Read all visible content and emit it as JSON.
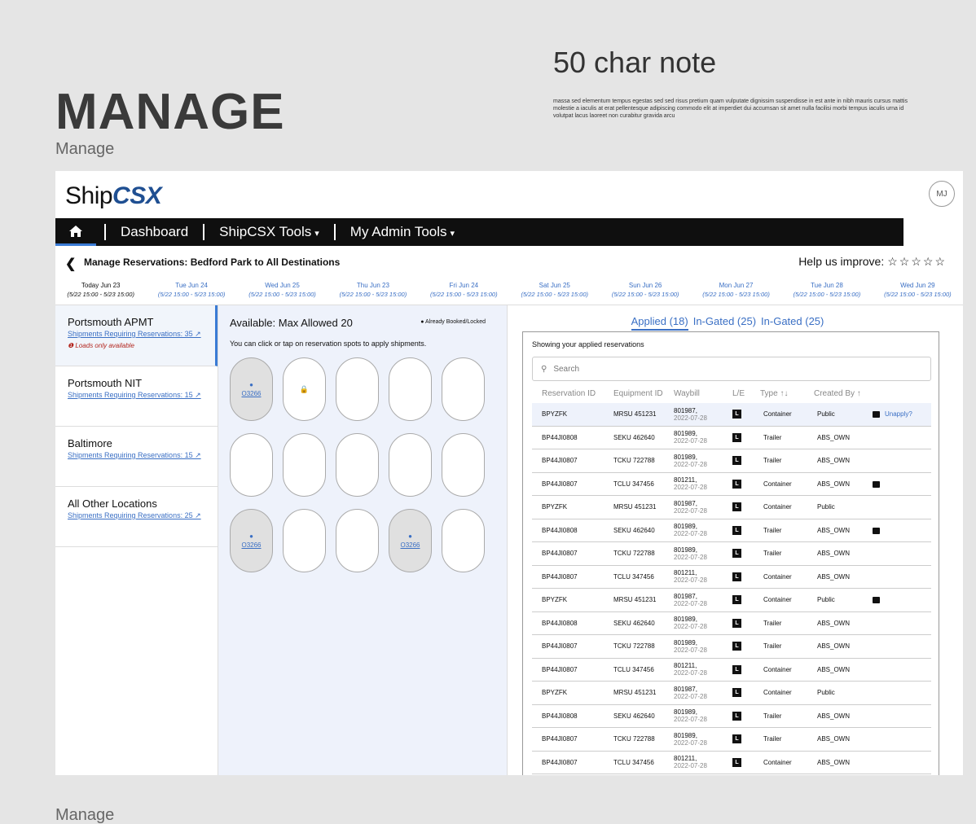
{
  "cover": {
    "title": "MANAGE",
    "subtitle": "Manage",
    "bottom_label": "Manage"
  },
  "note": {
    "title": "50 char note",
    "body": "massa sed elementum tempus egestas sed sed risus pretium quam vulputate dignissim suspendisse in est ante in nibh mauris cursus mattis molestie a iaculis at erat pellentesque adipiscing commodo elit at imperdiet dui accumsan sit amet nulla facilisi morbi tempus iaculis urna id volutpat lacus laoreet non curabitur gravida arcu"
  },
  "header": {
    "logo_ship": "Ship",
    "logo_csx": "CSX",
    "avatar": "MJ"
  },
  "nav": {
    "home_icon": "home-icon",
    "dashboard": "Dashboard",
    "tools": "ShipCSX Tools",
    "admin": "My Admin Tools",
    "caret": "▾"
  },
  "page": {
    "back": "❮",
    "title": "Manage Reservations: Bedford Park to All Destinations",
    "help": "Help us improve:",
    "stars": "☆☆☆☆☆"
  },
  "dates": [
    {
      "day": "Today Jun 23",
      "range": "(5/22 15:00 - 5/23 15:00)"
    },
    {
      "day": "Tue Jun 24",
      "range": "(5/22 15:00 - 5/23 15:00)"
    },
    {
      "day": "Wed Jun 25",
      "range": "(5/22 15:00 - 5/23 15:00)"
    },
    {
      "day": "Thu Jun 23",
      "range": "(5/22 15:00 - 5/23 15:00)"
    },
    {
      "day": "Fri Jun 24",
      "range": "(5/22 15:00 - 5/23 15:00)"
    },
    {
      "day": "Sat Jun 25",
      "range": "(5/22 15:00 - 5/23 15:00)"
    },
    {
      "day": "Sun Jun 26",
      "range": "(5/22 15:00 - 5/23 15:00)"
    },
    {
      "day": "Mon Jun 27",
      "range": "(5/22 15:00 - 5/23 15:00)"
    },
    {
      "day": "Tue Jun 28",
      "range": "(5/22 15:00 - 5/23 15:00)"
    },
    {
      "day": "Wed Jun 29",
      "range": "(5/22 15:00 - 5/23 15:00)"
    }
  ],
  "locations": [
    {
      "name": "Portsmouth APMT",
      "link": "Shipments Requiring Reservations: 35 ↗",
      "warn": "❶ Loads only available"
    },
    {
      "name": "Portsmouth NIT",
      "link": "Shipments Requiring Reservations: 15 ↗",
      "warn": ""
    },
    {
      "name": "Baltimore",
      "link": "Shipments Requiring Reservations: 15 ↗",
      "warn": ""
    },
    {
      "name": "All Other Locations",
      "link": "Shipments Requiring Reservations: 25 ↗",
      "warn": ""
    }
  ],
  "spots": {
    "available": "Available: Max Allowed 20",
    "booked_legend": "● Already Booked/Locked",
    "instructions": "You can click or tap on reservation spots to apply shipments.",
    "booked_code": "O3266",
    "user_icon": "●",
    "lock_icon": "🔒"
  },
  "tabs": {
    "applied": "Applied (18)",
    "ingated1": "In-Gated (25)",
    "ingated2": "In-Gated (25)"
  },
  "table": {
    "showing": "Showing your applied reservations",
    "search_placeholder": "Search",
    "search_icon": "⚲",
    "headers": {
      "res": "Reservation ID",
      "eq": "Equipment ID",
      "wb": "Waybill",
      "le": "L/E",
      "type": "Type ↑↓",
      "by": "Created By ↑"
    },
    "unapply": "Unapply?",
    "rows": [
      {
        "res": "BPYZFK",
        "eq": "MRSU 451231",
        "wb": "801987,",
        "date": "2022-07-28",
        "le": "L",
        "type": "Container",
        "by": "Public",
        "note": true,
        "unapply": true
      },
      {
        "res": "BP44JI0808",
        "eq": "SEKU 462640",
        "wb": "801989,",
        "date": "2022-07-28",
        "le": "L",
        "type": "Trailer",
        "by": "ABS_OWN",
        "note": false,
        "unapply": false
      },
      {
        "res": "BP44JI0807",
        "eq": "TCKU 722788",
        "wb": "801989,",
        "date": "2022-07-28",
        "le": "L",
        "type": "Trailer",
        "by": "ABS_OWN",
        "note": false,
        "unapply": false
      },
      {
        "res": "BP44JI0807",
        "eq": "TCLU 347456",
        "wb": "801211,",
        "date": "2022-07-28",
        "le": "L",
        "type": "Container",
        "by": "ABS_OWN",
        "note": true,
        "unapply": false
      },
      {
        "res": "BPYZFK",
        "eq": "MRSU 451231",
        "wb": "801987,",
        "date": "2022-07-28",
        "le": "L",
        "type": "Container",
        "by": "Public",
        "note": false,
        "unapply": false
      },
      {
        "res": "BP44JI0808",
        "eq": "SEKU 462640",
        "wb": "801989,",
        "date": "2022-07-28",
        "le": "L",
        "type": "Trailer",
        "by": "ABS_OWN",
        "note": true,
        "unapply": false
      },
      {
        "res": "BP44JI0807",
        "eq": "TCKU 722788",
        "wb": "801989,",
        "date": "2022-07-28",
        "le": "L",
        "type": "Trailer",
        "by": "ABS_OWN",
        "note": false,
        "unapply": false
      },
      {
        "res": "BP44JI0807",
        "eq": "TCLU 347456",
        "wb": "801211,",
        "date": "2022-07-28",
        "le": "L",
        "type": "Container",
        "by": "ABS_OWN",
        "note": false,
        "unapply": false
      },
      {
        "res": "BPYZFK",
        "eq": "MRSU 451231",
        "wb": "801987,",
        "date": "2022-07-28",
        "le": "L",
        "type": "Container",
        "by": "Public",
        "note": true,
        "unapply": false
      },
      {
        "res": "BP44JI0808",
        "eq": "SEKU 462640",
        "wb": "801989,",
        "date": "2022-07-28",
        "le": "L",
        "type": "Trailer",
        "by": "ABS_OWN",
        "note": false,
        "unapply": false
      },
      {
        "res": "BP44JI0807",
        "eq": "TCKU 722788",
        "wb": "801989,",
        "date": "2022-07-28",
        "le": "L",
        "type": "Trailer",
        "by": "ABS_OWN",
        "note": false,
        "unapply": false
      },
      {
        "res": "BP44JI0807",
        "eq": "TCLU 347456",
        "wb": "801211,",
        "date": "2022-07-28",
        "le": "L",
        "type": "Container",
        "by": "ABS_OWN",
        "note": false,
        "unapply": false
      },
      {
        "res": "BPYZFK",
        "eq": "MRSU 451231",
        "wb": "801987,",
        "date": "2022-07-28",
        "le": "L",
        "type": "Container",
        "by": "Public",
        "note": false,
        "unapply": false
      },
      {
        "res": "BP44JI0808",
        "eq": "SEKU 462640",
        "wb": "801989,",
        "date": "2022-07-28",
        "le": "L",
        "type": "Trailer",
        "by": "ABS_OWN",
        "note": false,
        "unapply": false
      },
      {
        "res": "BP44JI0807",
        "eq": "TCKU 722788",
        "wb": "801989,",
        "date": "2022-07-28",
        "le": "L",
        "type": "Trailer",
        "by": "ABS_OWN",
        "note": false,
        "unapply": false
      },
      {
        "res": "BP44JI0807",
        "eq": "TCLU 347456",
        "wb": "801211,",
        "date": "2022-07-28",
        "le": "L",
        "type": "Container",
        "by": "ABS_OWN",
        "note": false,
        "unapply": false
      }
    ]
  },
  "colors": {
    "accent": "#3a6fc4",
    "nav_bg": "#0f0f0f",
    "selected_row": "#eef2fb",
    "warn": "#b3261e"
  }
}
